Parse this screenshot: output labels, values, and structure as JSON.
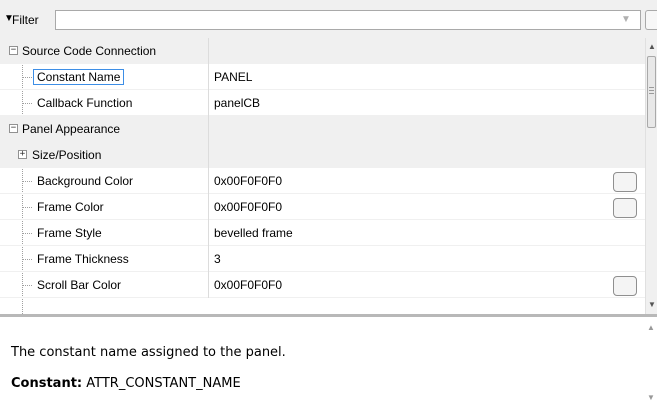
{
  "filter": {
    "label": "Filter",
    "funnel_glyph": "▼",
    "value": "",
    "placeholder": ""
  },
  "properties": [
    {
      "type": "category",
      "label": "Source Code Connection",
      "expanded": true
    },
    {
      "type": "property",
      "label": "Constant Name",
      "value": "PANEL",
      "selected": true
    },
    {
      "type": "property",
      "label": "Callback Function",
      "value": "panelCB"
    },
    {
      "type": "category",
      "label": "Panel Appearance",
      "expanded": true
    },
    {
      "type": "group",
      "label": "Size/Position",
      "expanded": false
    },
    {
      "type": "property",
      "label": "Background Color",
      "value": "0x00F0F0F0",
      "has_color_button": true
    },
    {
      "type": "property",
      "label": "Frame Color",
      "value": "0x00F0F0F0",
      "has_color_button": true
    },
    {
      "type": "property",
      "label": "Frame Style",
      "value": "bevelled frame"
    },
    {
      "type": "property",
      "label": "Frame Thickness",
      "value": "3"
    },
    {
      "type": "property",
      "label": "Scroll Bar Color",
      "value": "0x00F0F0F0",
      "has_color_button": true
    }
  ],
  "description": {
    "text": "The constant name assigned to the panel.",
    "constant_label": "Constant:",
    "constant_value": "ATTR_CONSTANT_NAME"
  },
  "colors": {
    "category_background": "#f0f0f0",
    "selection_border": "#3d8ee6",
    "grid_background": "#ffffff"
  }
}
